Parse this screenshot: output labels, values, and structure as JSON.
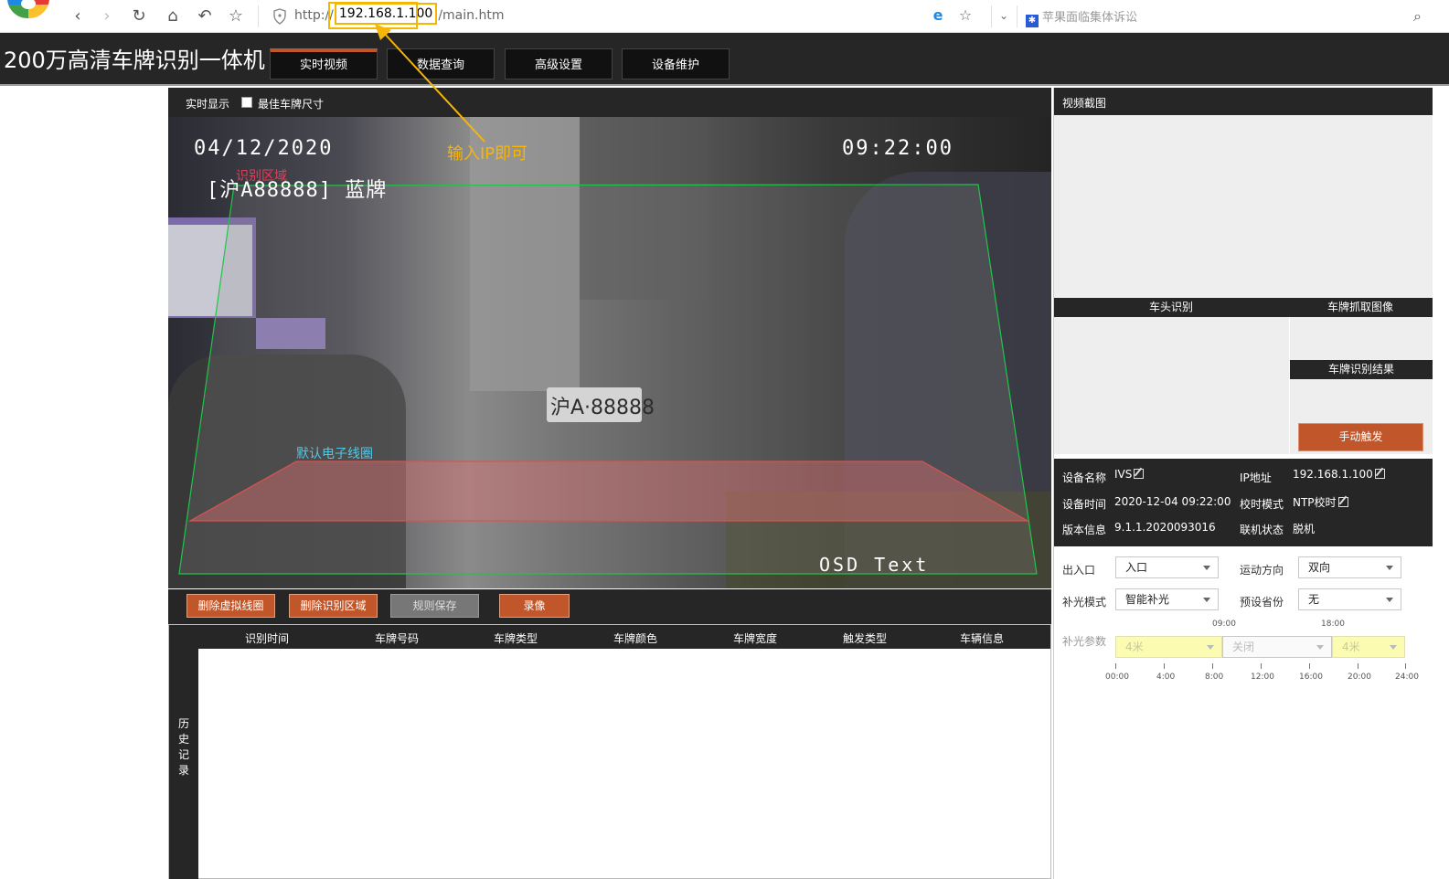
{
  "browser": {
    "url_prefix": "http://",
    "url_host": "192.168.1.100",
    "url_path": "/main.htm",
    "search_suggestion": "苹果面临集体诉讼"
  },
  "app": {
    "title": "200万高清车牌识别一体机",
    "tabs": [
      "实时视频",
      "数据查询",
      "高级设置",
      "设备维护"
    ],
    "active_tab": "实时视频"
  },
  "video": {
    "toolbar_label": "实时显示",
    "checkbox_label": "最佳车牌尺寸",
    "osd_date": "04/12/2020",
    "osd_time": "09:22:00",
    "osd_plate": "[沪A88888] 蓝牌",
    "region_label": "识别区域",
    "line_label": "默认电子线圈",
    "osd_text": "OSD Text",
    "plate_sign": "沪A·88888"
  },
  "annotation": {
    "text": "输入IP即可",
    "color": "#f6b50a"
  },
  "controls": {
    "delete_virtual_loop": "删除虚拟线圈",
    "delete_region": "删除识别区域",
    "save_rules": "规则保存",
    "record": "录像"
  },
  "history": {
    "side_label": "历史记录",
    "columns": [
      "识别时间",
      "车牌号码",
      "车牌类型",
      "车牌颜色",
      "车牌宽度",
      "触发类型",
      "车辆信息"
    ],
    "rows": []
  },
  "right": {
    "snapshot_header": "视频截图",
    "label_head": "车头识别",
    "label_capture": "车牌抓取图像",
    "label_result": "车牌识别结果",
    "manual_trigger": "手动触发",
    "device": {
      "name_label": "设备名称",
      "name_value": "IVS",
      "ip_label": "IP地址",
      "ip_value": "192.168.1.100",
      "time_label": "设备时间",
      "time_value": "2020-12-04 09:22:00",
      "sync_label": "校时模式",
      "sync_value": "NTP校时",
      "version_label": "版本信息",
      "version_value": "9.1.1.2020093016",
      "status_label": "联机状态",
      "status_value": "脱机"
    },
    "form": {
      "entrance_label": "出入口",
      "entrance_value": "入口",
      "direction_label": "运动方向",
      "direction_value": "双向",
      "light_mode_label": "补光模式",
      "light_mode_value": "智能补光",
      "province_label": "预设省份",
      "province_value": "无",
      "light_param_label": "补光参数",
      "segment_marks": [
        "09:00",
        "18:00"
      ],
      "segments": [
        "4米",
        "关闭",
        "4米"
      ],
      "timeline": [
        "00:00",
        "4:00",
        "8:00",
        "12:00",
        "16:00",
        "20:00",
        "24:00"
      ]
    }
  },
  "colors": {
    "accent": "#c0562a",
    "dark": "#262626",
    "region": "#22c44a",
    "loop": "#d9534f"
  }
}
